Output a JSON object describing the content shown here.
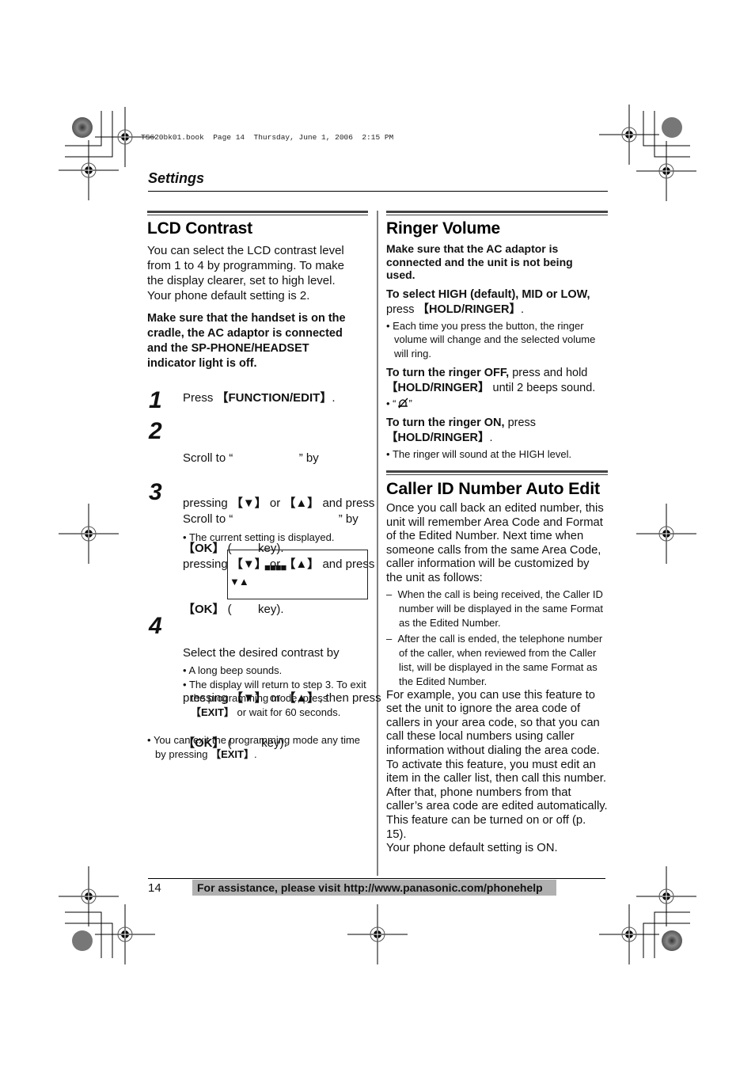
{
  "slug": "TS620bk01.book  Page 14  Thursday, June 1, 2006  2:15 PM",
  "running_head": "Settings",
  "lcd_contrast": {
    "title": "LCD Contrast",
    "intro": [
      "You can select the LCD contrast level",
      "from 1 to 4 by programming. To make",
      "the display clearer, set to high level.",
      "Your phone default setting is 2."
    ],
    "warning": [
      "Make sure that the handset is on the",
      "cradle, the AC adaptor is connected",
      "and the SP-PHONE/HEADSET",
      "indicator light is off."
    ],
    "steps": [
      {
        "num": "1",
        "lines": [
          "Press 【FUNCTION/EDIT】."
        ]
      },
      {
        "num": "2",
        "lines": [
          "Scroll to “                    ” by",
          "pressing 【▼】 or 【▲】 and press",
          "【OK】 (        key)."
        ]
      },
      {
        "num": "3",
        "lines": [
          "Scroll to “                                ” by",
          "pressing 【▼】 or 【▲】 and press",
          "【OK】 (        key)."
        ],
        "bullets": [
          "The current setting is displayed."
        ]
      },
      {
        "num": "4",
        "lines": [
          "Select the desired contrast by",
          "pressing 【▼】 or 【▲】, then press",
          "【OK】 (         key)."
        ],
        "bullets": [
          "A long beep sounds.",
          "The display will return to step 3. To exit the programming mode, press 【EXIT】 or wait for 60 seconds."
        ]
      }
    ],
    "lcd_display": {
      "bars": "■■■■",
      "arrows": "▼▲",
      "contrast_level": 4,
      "contrast_max": 4
    },
    "note": "You can exit the programming mode any time by pressing 【EXIT】."
  },
  "ringer_volume": {
    "title": "Ringer Volume",
    "warning": [
      "Make sure that the AC adaptor is",
      "connected and the unit is not being",
      "used."
    ],
    "select_bold": "To select HIGH (default), MID or LOW,",
    "select_rest": "press 【HOLD/RINGER】.",
    "select_bullet": "Each time you press the button, the ringer volume will change and the selected volume will ring.",
    "off_bold": "To turn the ringer OFF,",
    "off_rest": "press and hold 【HOLD/RINGER】 until 2 beeps sound.",
    "off_bullet_icon": "ringer-off-icon",
    "on_bold": "To turn the ringer ON,",
    "on_rest": "press 【HOLD/RINGER】.",
    "on_bullet": "The ringer will sound at the HIGH level."
  },
  "caller_id": {
    "title": "Caller ID Number Auto Edit",
    "intro": "Once you call back an edited number, this unit will remember Area Code and Format of the Edited Number. Next time when someone calls from the same Area Code, caller information will be customized by the unit as follows:",
    "dashes": [
      "When the call is being received, the Caller ID number will be displayed in the same Format as the Edited Number.",
      "After the call is ended, the telephone number of the caller, when reviewed from the Caller list, will be displayed in the same Format as the Edited Number."
    ],
    "example": "For example, you can use this feature to set the unit to ignore the area code of callers in your area code, so that you can call these local numbers using caller information without dialing the area code. To activate this feature, you must edit an item in the caller list, then call this number. After that, phone numbers from that caller’s area code are edited automatically. This feature can be turned on or off (p. 15).",
    "default": "Your phone default setting is ON."
  },
  "footer": {
    "page_number": "14",
    "assistance": "For assistance, please visit http://www.panasonic.com/phonehelp"
  }
}
